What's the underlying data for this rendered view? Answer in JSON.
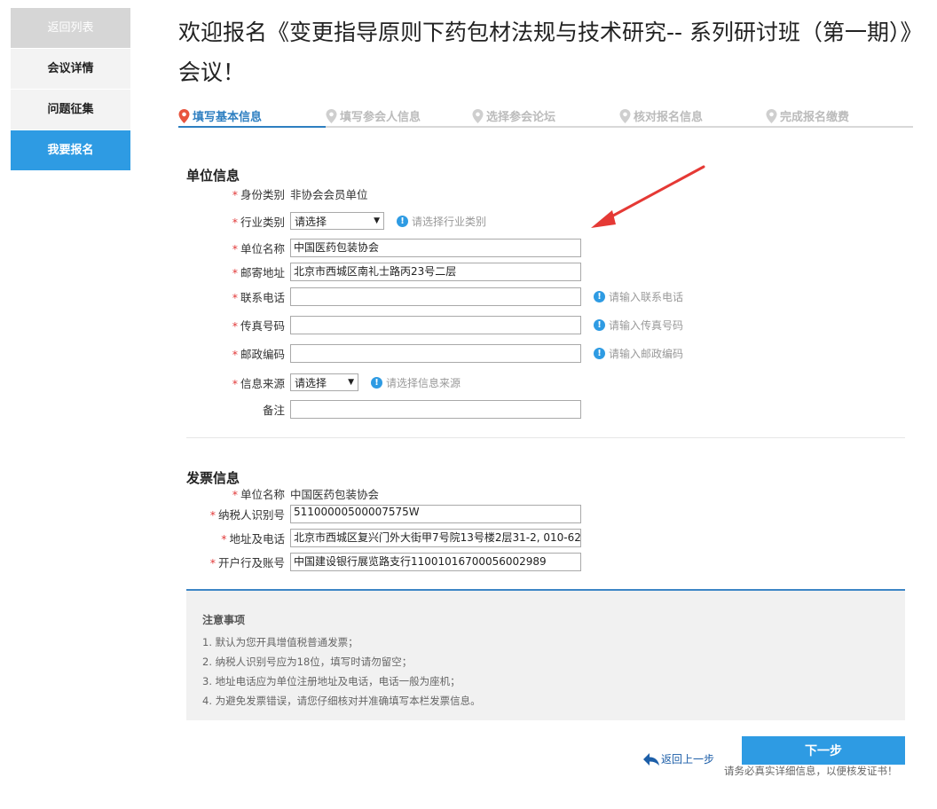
{
  "sidebar": {
    "items": [
      {
        "label": "返回列表"
      },
      {
        "label": "会议详情"
      },
      {
        "label": "问题征集"
      },
      {
        "label": "我要报名"
      }
    ]
  },
  "page_title": "欢迎报名《变更指导原则下药包材法规与技术研究-- 系列研讨班（第一期）》会议！",
  "steps": [
    {
      "label": "填写基本信息"
    },
    {
      "label": "填写参会人信息"
    },
    {
      "label": "选择参会论坛"
    },
    {
      "label": "核对报名信息"
    },
    {
      "label": "完成报名缴费"
    }
  ],
  "org": {
    "section_title": "单位信息",
    "required_mark": "*",
    "identity_label": "身份类别",
    "identity_value": "非协会会员单位",
    "industry_label": "行业类别",
    "industry_selected": "请选择",
    "industry_hint": "请选择行业类别",
    "name_label": "单位名称",
    "name_value": "中国医药包装协会",
    "address_label": "邮寄地址",
    "address_value": "北京市西城区南礼士路丙23号二层",
    "phone_label": "联系电话",
    "phone_value": "",
    "phone_hint": "请输入联系电话",
    "fax_label": "传真号码",
    "fax_value": "",
    "fax_hint": "请输入传真号码",
    "zip_label": "邮政编码",
    "zip_value": "",
    "zip_hint": "请输入邮政编码",
    "source_label": "信息来源",
    "source_selected": "请选择",
    "source_hint": "请选择信息来源",
    "remark_label": "备注",
    "remark_value": ""
  },
  "invoice": {
    "section_title": "发票信息",
    "name_label": "单位名称",
    "name_value": "中国医药包装协会",
    "tax_label": "纳税人识别号",
    "tax_value": "51100000500007575W",
    "addr_label": "地址及电话",
    "addr_value": "北京市西城区复兴门外大街甲7号院13号楼2层31-2, 010-62",
    "bank_label": "开户行及账号",
    "bank_value": "中国建设银行展览路支行11001016700056002989"
  },
  "notes": {
    "title": "注意事项",
    "items": [
      "1. 默认为您开具增值税普通发票；",
      "2. 纳税人识别号应为18位，填写时请勿留空；",
      "3. 地址电话应为单位注册地址及电话，电话一般为座机；",
      "4. 为避免发票错误，请您仔细核对并准确填写本栏发票信息。"
    ]
  },
  "actions": {
    "back_label": "返回上一步",
    "next_label": "下一步",
    "footnote": "请务必真实详细信息，以便核发证书！"
  },
  "colors": {
    "accent": "#2e9be3",
    "step_active": "#2e7fc1",
    "required": "#e23a3a",
    "annotation_arrow": "#e53935"
  }
}
